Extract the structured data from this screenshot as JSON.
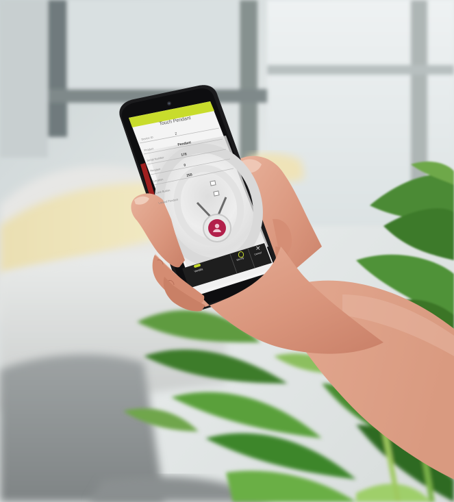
{
  "app": {
    "title": "Touch Pendant",
    "fields": [
      {
        "label": "Device ID",
        "value": "2"
      },
      {
        "label": "Product",
        "value": "Pendant"
      },
      {
        "label": "Serial Number",
        "value": "176"
      },
      {
        "label": "Pendant",
        "value": "0"
      },
      {
        "label": "Location",
        "value": "255"
      }
    ],
    "checkboxes": [
      {
        "label": "Lock Button",
        "checked": false
      },
      {
        "label": "Locked Pendant",
        "checked": false
      }
    ],
    "nav": [
      {
        "label": "Ventilla",
        "icon": "ventilla-logo-icon"
      },
      {
        "label": "Identify",
        "icon": "lightbulb-icon"
      },
      {
        "label": "Cancel",
        "icon": "close-icon"
      }
    ]
  },
  "colors": {
    "accent": "#c8dc2c",
    "pendant": "#b2204b",
    "nav_bar": "#1e1e1e",
    "screen_bg": "#f2f2f2"
  }
}
